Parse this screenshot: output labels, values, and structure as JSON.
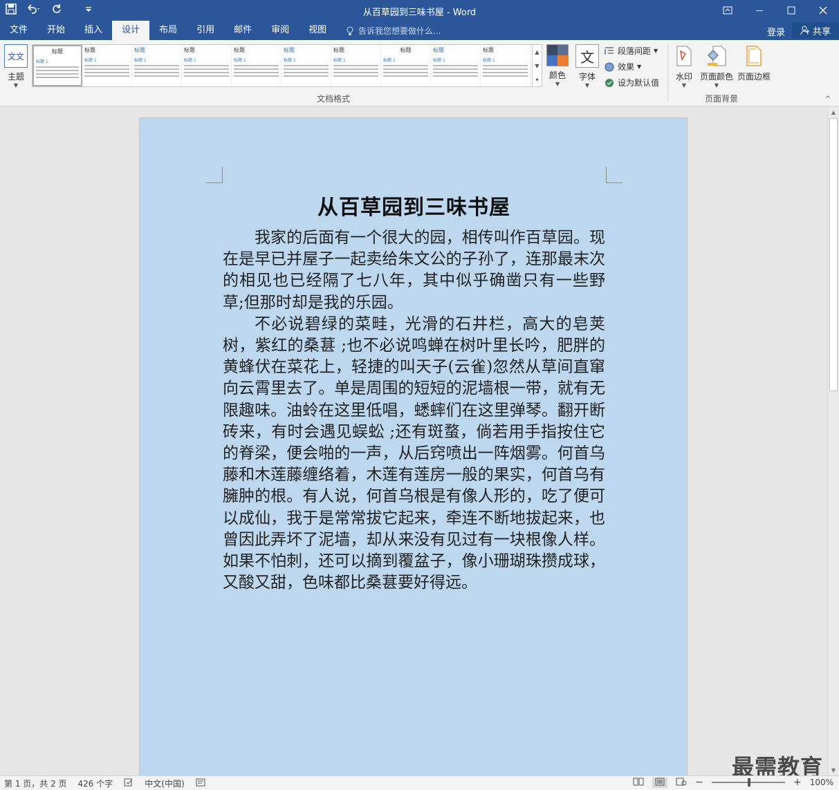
{
  "titlebar": {
    "title": "从百草园到三味书屋 - Word",
    "save_icon": "save-icon",
    "undo_icon": "undo-icon",
    "redo_icon": "redo-icon",
    "customize_icon": "customize-qat-icon"
  },
  "tabs": [
    "文件",
    "开始",
    "插入",
    "设计",
    "布局",
    "引用",
    "邮件",
    "审阅",
    "视图"
  ],
  "active_tab": "设计",
  "tellme": {
    "placeholder": "告诉我您想要做什么..."
  },
  "account": {
    "login": "登录",
    "share": "共享"
  },
  "ribbon": {
    "theme_label": "主题",
    "theme_icon_text": "文文",
    "gallery": [
      {
        "title": "标题",
        "heading": "标题 1"
      },
      {
        "title": "标题",
        "heading": "标题 1"
      },
      {
        "title": "标题",
        "heading": "标题 1"
      },
      {
        "title": "标题",
        "heading": "标题 1"
      },
      {
        "title": "标题",
        "heading": "标题 1"
      },
      {
        "title": "标题",
        "heading": "标题 1"
      },
      {
        "title": "标题",
        "heading": "标题 1"
      },
      {
        "title": "标题",
        "heading": "标题 1"
      },
      {
        "title": "标题",
        "heading": "标题 1"
      },
      {
        "title": "标题",
        "heading": "标题 1"
      }
    ],
    "colors_label": "颜色",
    "fonts_label": "字体",
    "fonts_icon_text": "文",
    "paragraph_spacing_label": "段落间距",
    "effects_label": "效果",
    "set_default_label": "设为默认值",
    "doc_format_group": "文档格式",
    "watermark_label": "水印",
    "page_color_label": "页面颜色",
    "page_borders_label": "页面边框",
    "page_background_group": "页面背景"
  },
  "document": {
    "title": "从百草园到三味书屋",
    "paragraphs": [
      "我家的后面有一个很大的园，相传叫作百草园。现在是早已并屋子一起卖给朱文公的子孙了，连那最末次的相见也已经隔了七八年，其中似乎确凿只有一些野草;但那时却是我的乐园。",
      "不必说碧绿的菜畦，光滑的石井栏，高大的皂荚树，紫红的桑葚 ;也不必说鸣蝉在树叶里长吟，肥胖的黄蜂伏在菜花上，轻捷的叫天子(云雀)忽然从草间直窜向云霄里去了。单是周围的短短的泥墙根一带，就有无限趣味。油蛉在这里低唱，蟋蟀们在这里弹琴。翻开断砖来，有时会遇见蜈蚣 ;还有斑蝥，倘若用手指按住它的脊梁，便会啪的一声，从后窍喷出一阵烟雾。何首乌藤和木莲藤缠络着，木莲有莲房一般的果实，何首乌有臃肿的根。有人说，何首乌根是有像人形的，吃了便可以成仙，我于是常常拔它起来，牵连不断地拔起来，也曾因此弄坏了泥墙，却从来没有见过有一块根像人样。如果不怕刺，还可以摘到覆盆子，像小珊瑚珠攒成球，又酸又甜，色味都比桑葚要好得远。"
    ],
    "page_color": "#bdd7ee"
  },
  "watermark_text": "最需教育",
  "status": {
    "page": "第 1 页，共 2 页",
    "words": "426 个字",
    "language": "中文(中国)",
    "zoom": "100%"
  },
  "colors": {
    "accent": "#2b579a",
    "ribbon_bg": "#f3f3f3",
    "canvas_bg": "#e6e6e6"
  }
}
